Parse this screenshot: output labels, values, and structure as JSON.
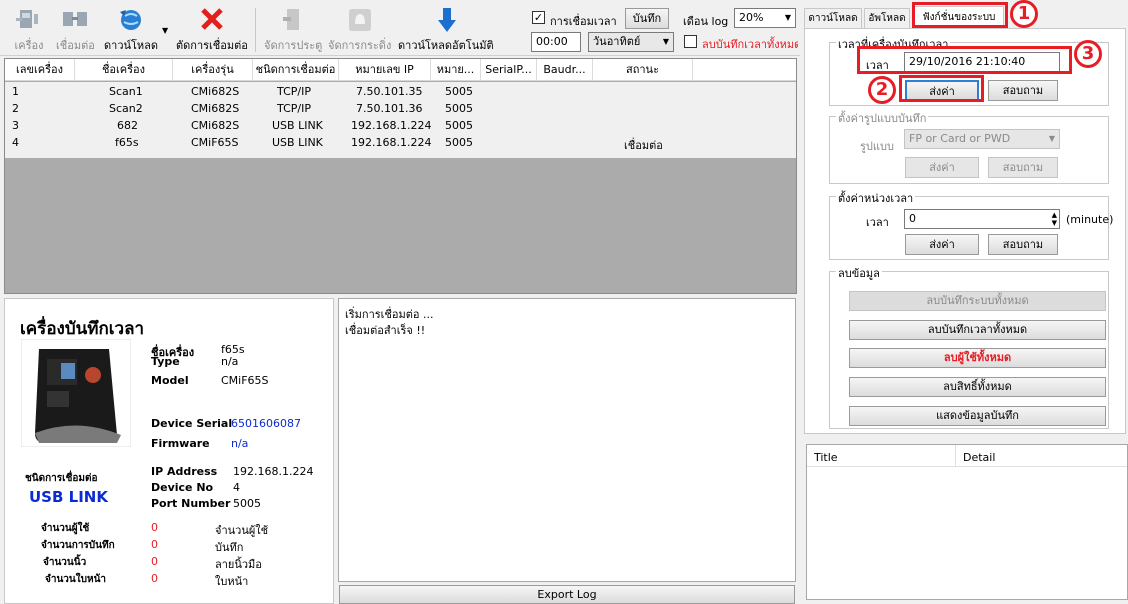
{
  "toolbar": {
    "machine": "เครื่อง",
    "connect": "เชื่อมต่อ",
    "download": "ดาวน์โหลด",
    "disconnect": "ตัดการเชื่อมต่อ",
    "door": "จัดการประตู",
    "bell": "จัดการกระดิ่ง",
    "auto_download": "ดาวน์โหลดอัตโนมัติ",
    "sync_time_label": "การเชื่อมเวลา",
    "save_label": "บันทึก",
    "month_log_label": "เดือน log",
    "month_log_value": "20%",
    "time_value": "00:00",
    "day_value": "วันอาทิตย์",
    "delete_all_label": "ลบบันทึกเวลาทั้งหมด"
  },
  "grid": {
    "columns": [
      "เลขเครื่อง",
      "ชื่อเครื่อง",
      "เครื่องรุ่น",
      "ชนิดการเชื่อมต่อ",
      "หมายเลข IP",
      "หมาย...",
      "SerialP...",
      "Baudr...",
      "สถานะ"
    ],
    "rows": [
      {
        "no": "1",
        "name": "Scan1",
        "model": "CMi682S",
        "conn": "TCP/IP",
        "ip": "7.50.101.35",
        "port": "5005",
        "status": ""
      },
      {
        "no": "2",
        "name": "Scan2",
        "model": "CMi682S",
        "conn": "TCP/IP",
        "ip": "7.50.101.36",
        "port": "5005",
        "status": ""
      },
      {
        "no": "3",
        "name": "682",
        "model": "CMi682S",
        "conn": "USB LINK",
        "ip": "192.168.1.224",
        "port": "5005",
        "status": ""
      },
      {
        "no": "4",
        "name": "f65s",
        "model": "CMiF65S",
        "conn": "USB LINK",
        "ip": "192.168.1.224",
        "port": "5005",
        "status": "เชื่อมต่อ"
      }
    ]
  },
  "device": {
    "title": "เครื่องบันทึกเวลา",
    "name_label": "ชื่อเครื่อง",
    "name_value": "f65s",
    "type_label": "Type",
    "type_value": "n/a",
    "model_label": "Model",
    "model_value": "CMiF65S",
    "serial_label": "Device Serial",
    "serial_value": "6501606087",
    "firmware_label": "Firmware",
    "firmware_value": "n/a",
    "conn_type_label": "ชนิดการเชื่อมต่อ",
    "conn_type_value": "USB LINK",
    "ip_label": "IP Address",
    "ip_value": "192.168.1.224",
    "devno_label": "Device No",
    "devno_value": "4",
    "port_label": "Port Number",
    "port_value": "5005",
    "counts": [
      {
        "label": "จำนวนผู้ใช้",
        "value": "0",
        "unit": "จำนวนผู้ใช้"
      },
      {
        "label": "จำนวนการบันทึก",
        "value": "0",
        "unit": "บันทึก"
      },
      {
        "label": "จำนวนนิ้ว",
        "value": "0",
        "unit": "ลายนิ้วมือ"
      },
      {
        "label": "จำนวนใบหน้า",
        "value": "0",
        "unit": "ใบหน้า"
      }
    ]
  },
  "log": {
    "lines": [
      "เริ่มการเชื่อมต่อ ...",
      "เชื่อมต่อสำเร็จ !!"
    ],
    "export_label": "Export Log"
  },
  "right": {
    "tabs": [
      "ดาวน์โหลด",
      "อัพโหลด",
      "ฟังก์ชั่นของระบบ"
    ],
    "set_time_group": "เวลาที่เครื่องบันทึกเวลา",
    "time_label": "เวลา",
    "time_value": "29/10/2016 21:10:40",
    "send_label": "ส่งค่า",
    "query_label": "สอบถาม",
    "format_group": "ตั้งค่ารูปแบบบันทึก",
    "format_label": "รูปแบบ",
    "format_value": "FP or Card or PWD",
    "delay_group": "ตั้งค่าหน่วงเวลา",
    "delay_label": "เวลา",
    "delay_value": "0",
    "delay_unit": "(minute)",
    "delete_group": "ลบข้อมูล",
    "delete_buttons": [
      "ลบบันทึกระบบทั้งหมด",
      "ลบบันทึกเวลาทั้งหมด",
      "ลบผู้ใช้ทั้งหมด",
      "ลบสิทธิ์ทั้งหมด",
      "แสดงข้อมูลบันทึก"
    ],
    "detail_cols": [
      "Title",
      "Detail"
    ]
  },
  "annotations": [
    "1",
    "2",
    "3"
  ],
  "colors": {
    "accent": "#e81c24",
    "link": "#0a2bd4"
  }
}
